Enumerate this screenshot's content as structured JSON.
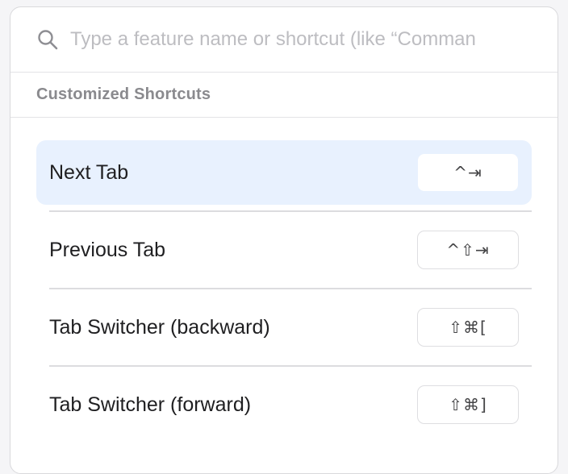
{
  "search": {
    "icon": "search-icon",
    "placeholder": "Type a feature name or shortcut (like “Comman",
    "value": ""
  },
  "section": {
    "title": "Customized Shortcuts"
  },
  "shortcuts": [
    {
      "label": "Next Tab",
      "keys": "^⇥",
      "selected": true
    },
    {
      "label": "Previous Tab",
      "keys": "^⇧⇥",
      "selected": false
    },
    {
      "label": "Tab Switcher (backward)",
      "keys": "⇧⌘[",
      "selected": false
    },
    {
      "label": "Tab Switcher (forward)",
      "keys": "⇧⌘]",
      "selected": false
    }
  ],
  "colors": {
    "selected_row": "#e8f1fe",
    "header_text": "#8a8a8e",
    "placeholder": "#bdbdc1"
  }
}
